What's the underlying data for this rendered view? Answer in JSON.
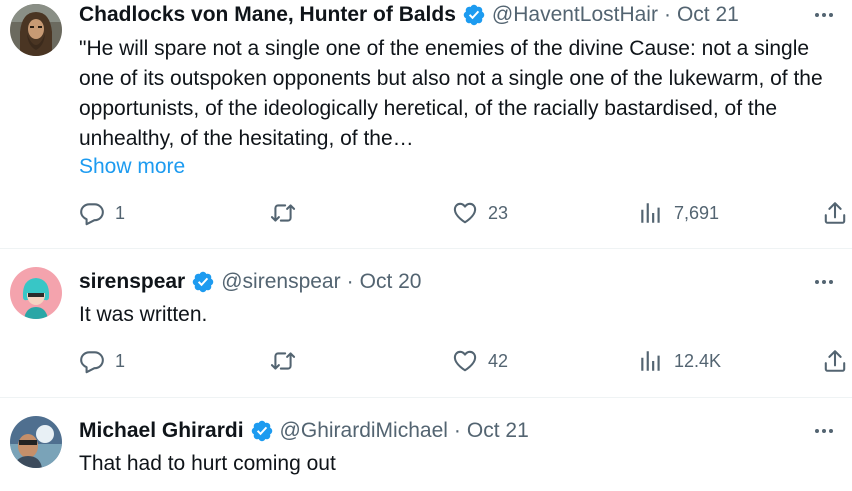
{
  "tweets": [
    {
      "name": "Chadlocks von Mane, Hunter of Balds",
      "handle": "@HaventLostHair",
      "separator": "·",
      "date": "Oct 21",
      "text": "\"He will spare not a single one of the enemies of the divine Cause: not a single one of its outspoken opponents but also not a single one of the lukewarm, of the opportunists, of the ideologically heretical, of the racially bastardised, of the unhealthy, of the hesitating, of the…",
      "show_more": "Show more",
      "replies": "1",
      "retweets": "",
      "likes": "23",
      "views": "7,691"
    },
    {
      "name": "sirenspear",
      "handle": "@sirenspear",
      "separator": "·",
      "date": "Oct 20",
      "text": "It was written.",
      "replies": "1",
      "retweets": "",
      "likes": "42",
      "views": "12.4K"
    },
    {
      "name": "Michael Ghirardi",
      "handle": "@GhirardiMichael",
      "separator": "·",
      "date": "Oct 21",
      "text": "That had to hurt coming out"
    }
  ],
  "icons": {
    "verified": "verified-badge-icon",
    "reply": "reply-icon",
    "retweet": "retweet-icon",
    "like": "heart-icon",
    "views": "views-chart-icon",
    "share": "share-icon",
    "more": "more-options-icon"
  },
  "colors": {
    "accent": "#1d9bf0",
    "muted": "#536471",
    "text": "#0f1419",
    "divider": "#eff3f4"
  }
}
